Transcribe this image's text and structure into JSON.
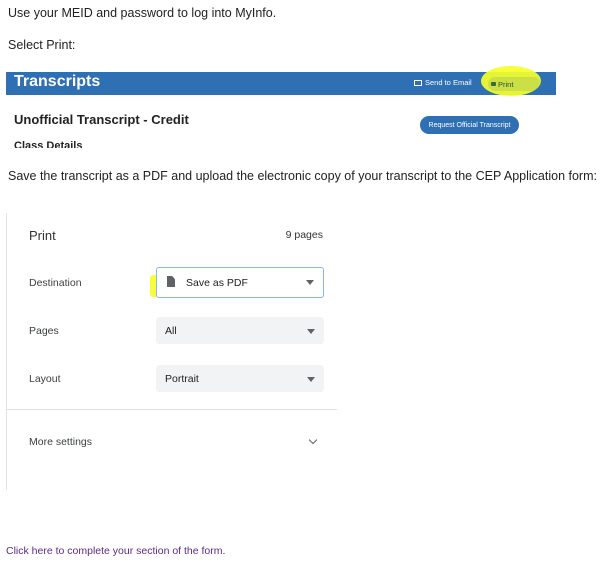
{
  "instructions": {
    "step1": "Use your MEID and password to log into MyInfo.",
    "step2": "Select Print:",
    "step3": "Save the transcript as a PDF and upload the electronic copy of your transcript to the CEP Application form:"
  },
  "transcripts_screen": {
    "banner_title": "Transcripts",
    "send_email_label": "Send to Email",
    "print_label": "Print",
    "heading": "Unofficial Transcript - Credit",
    "request_button_label": "Request Official Transcript",
    "section_label": "Class Details",
    "banner_color": "#2f6fb3",
    "highlight_color": "#f5ff28",
    "icons": [
      "mail-icon",
      "print-icon"
    ]
  },
  "print_dialog": {
    "title": "Print",
    "page_count": "9 pages",
    "destination_label": "Destination",
    "destination_value": "Save as PDF",
    "pages_label": "Pages",
    "pages_value": "All",
    "layout_label": "Layout",
    "layout_value": "Portrait",
    "more_settings_label": "More settings",
    "icons": [
      "document-icon",
      "chevron-down-icon"
    ]
  },
  "footer": {
    "link_text": "Click here to complete your section of the form.",
    "link_color": "#5b2a86"
  }
}
